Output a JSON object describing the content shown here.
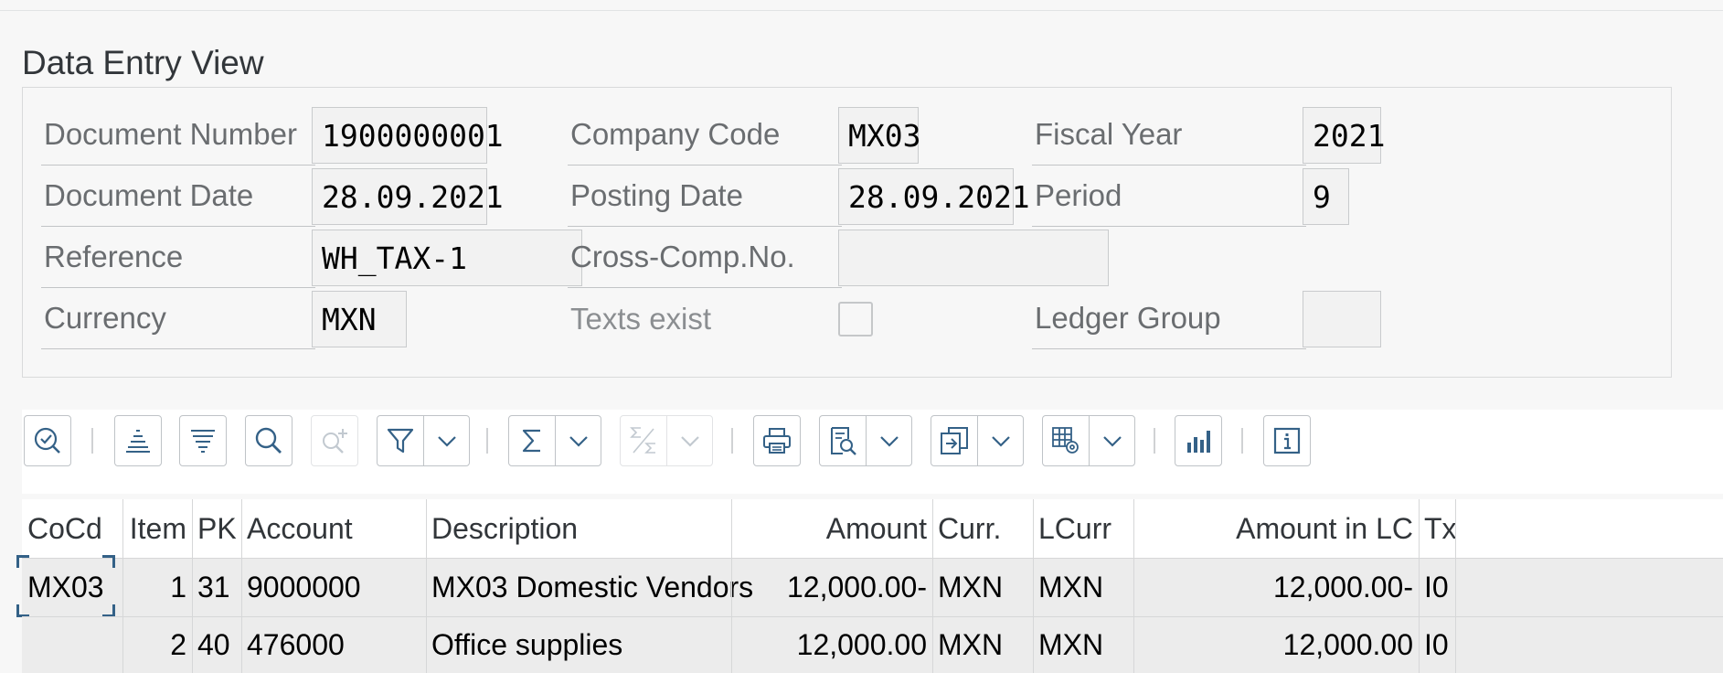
{
  "section": {
    "title": "Data Entry View"
  },
  "header_fields": {
    "document_number": {
      "label": "Document Number",
      "value": "1900000001"
    },
    "company_code": {
      "label": "Company Code",
      "value": "MX03"
    },
    "fiscal_year": {
      "label": "Fiscal Year",
      "value": "2021"
    },
    "document_date": {
      "label": "Document Date",
      "value": "28.09.2021"
    },
    "posting_date": {
      "label": "Posting Date",
      "value": "28.09.2021"
    },
    "period": {
      "label": "Period",
      "value": "9"
    },
    "reference": {
      "label": "Reference",
      "value": "WH_TAX-1"
    },
    "cross_comp_no": {
      "label": "Cross-Comp.No.",
      "value": ""
    },
    "currency": {
      "label": "Currency",
      "value": "MXN"
    },
    "texts_exist": {
      "label": "Texts exist",
      "checked": false
    },
    "ledger_group": {
      "label": "Ledger Group",
      "value": ""
    }
  },
  "toolbar": {
    "icons": [
      "details-icon",
      "sort-ascending-icon",
      "sort-descending-icon",
      "find-icon",
      "find-next-icon",
      "filter-icon",
      "sum-icon",
      "subtotals-icon",
      "print-icon",
      "print-preview-icon",
      "export-icon",
      "layout-settings-icon",
      "chart-icon",
      "info-icon"
    ]
  },
  "table": {
    "columns": [
      "CoCd",
      "Item",
      "PK",
      "Account",
      "Description",
      "Amount",
      "Curr.",
      "LCurr",
      "Amount in LC",
      "Tx"
    ],
    "rows": [
      {
        "cocd": "MX03",
        "item": "1",
        "pk": "31",
        "account": "9000000",
        "description": "MX03 Domestic Vendors",
        "amount": "12,000.00-",
        "curr": "MXN",
        "lcurr": "MXN",
        "amount_lc": "12,000.00-",
        "tx": "I0"
      },
      {
        "cocd": "",
        "item": "2",
        "pk": "40",
        "account": "476000",
        "description": "Office supplies",
        "amount": "12,000.00",
        "curr": "MXN",
        "lcurr": "MXN",
        "amount_lc": "12,000.00",
        "tx": "I0"
      }
    ]
  }
}
